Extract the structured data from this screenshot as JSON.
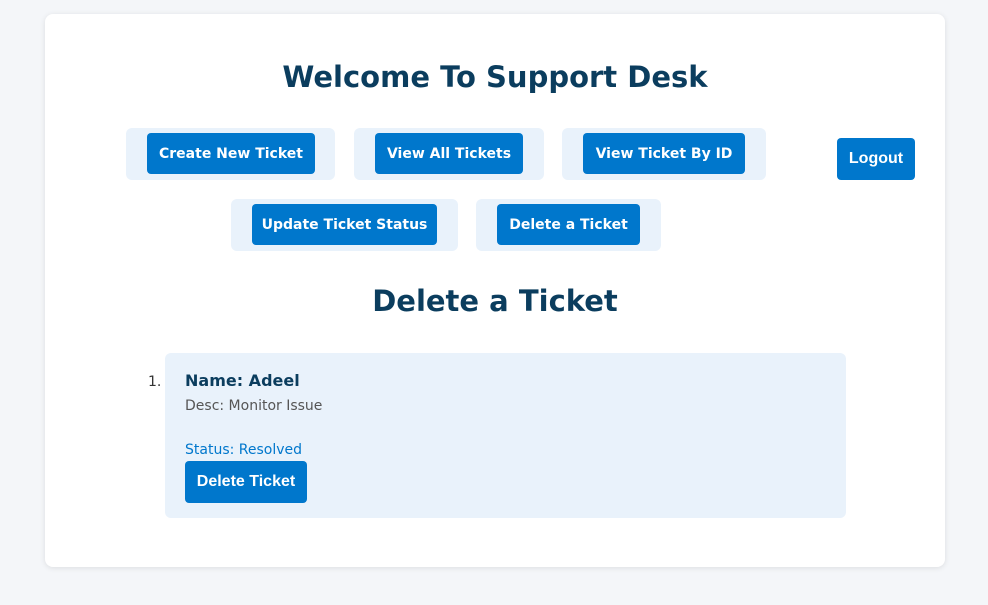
{
  "header": {
    "title": "Welcome To Support Desk",
    "logout_label": "Logout"
  },
  "nav": {
    "create_label": "Create New Ticket",
    "view_all_label": "View All Tickets",
    "view_by_id_label": "View Ticket By ID",
    "update_status_label": "Update Ticket Status",
    "delete_label": "Delete a Ticket"
  },
  "section": {
    "title": "Delete a Ticket"
  },
  "tickets": [
    {
      "index": "1.",
      "name": "Name: Adeel",
      "desc": "Desc: Monitor Issue",
      "status": "Status: Resolved",
      "delete_label": "Delete Ticket"
    }
  ],
  "colors": {
    "primary": "#0077cc",
    "heading": "#0b3d5e",
    "tile_bg": "#e9f2fb",
    "page_bg": "#f4f6f9"
  }
}
